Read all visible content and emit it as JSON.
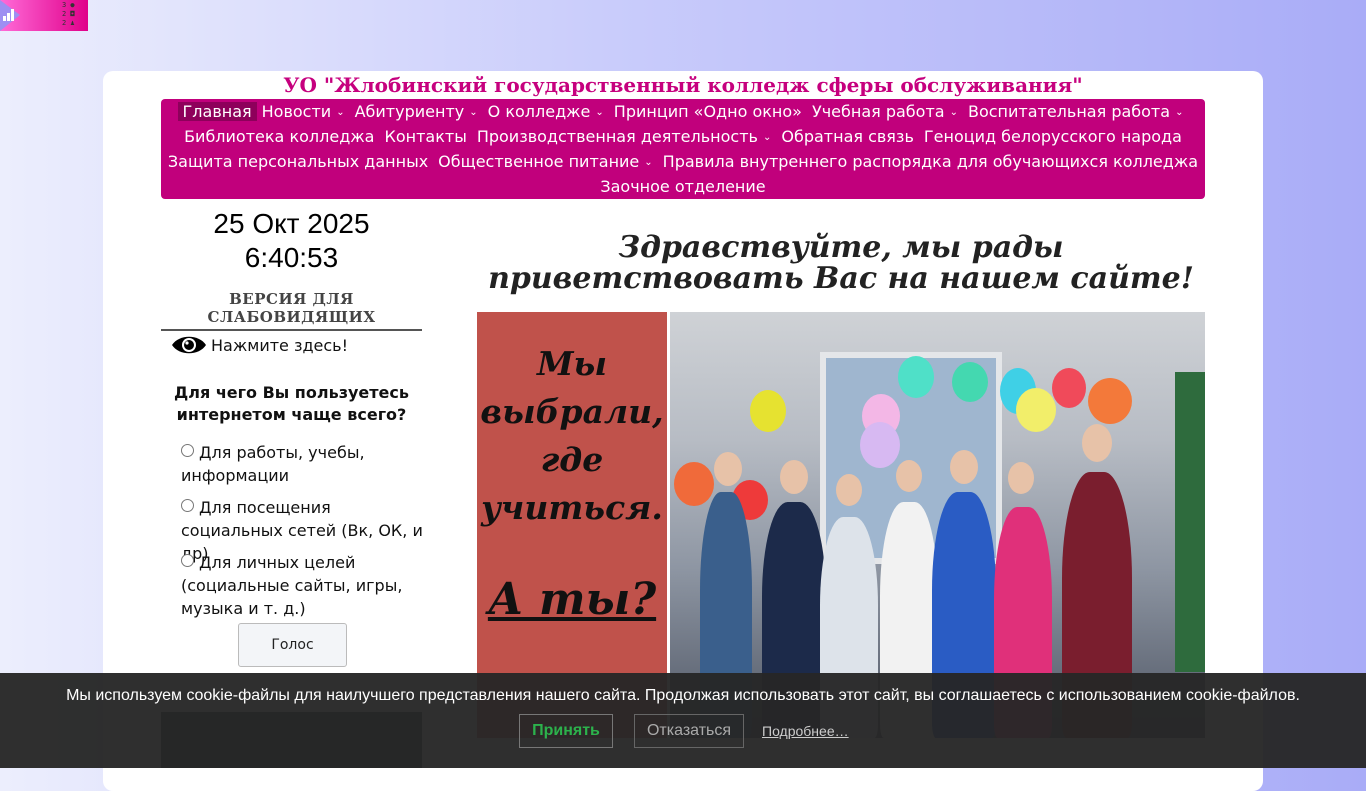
{
  "counter": {
    "numbers": [
      "3",
      "2",
      "2"
    ]
  },
  "site": {
    "title": "УО \"Жлобинский государственный колледж сферы обслуживания\""
  },
  "nav": {
    "rows": [
      [
        {
          "label": "Главная",
          "active": true,
          "dropdown": false
        },
        {
          "label": "Новости",
          "dropdown": true
        },
        {
          "label": "Абитуриенту",
          "dropdown": true
        },
        {
          "label": "О колледже",
          "dropdown": true
        },
        {
          "label": "Принцип «Одно окно»",
          "dropdown": false
        },
        {
          "label": "Учебная работа",
          "dropdown": true
        },
        {
          "label": "Воспитательная работа",
          "dropdown": true
        }
      ],
      [
        {
          "label": "Библиотека колледжа",
          "dropdown": false
        },
        {
          "label": "Контакты",
          "dropdown": false
        },
        {
          "label": "Производственная деятельность",
          "dropdown": true
        },
        {
          "label": "Обратная связь",
          "dropdown": false
        },
        {
          "label": "Геноцид белорусского народа",
          "dropdown": false
        }
      ],
      [
        {
          "label": "Защита персональных данных",
          "dropdown": false
        },
        {
          "label": "Общественное питание",
          "dropdown": true
        },
        {
          "label": "Правила внутреннего распорядка для обучающихся колледжа",
          "dropdown": false
        }
      ],
      [
        {
          "label": "Заочное отделение",
          "dropdown": false
        }
      ]
    ]
  },
  "clock": {
    "date": "25 Окт 2025",
    "time": "6:40:53"
  },
  "accessibility": {
    "heading": "ВЕРСИЯ ДЛЯ СЛАБОВИДЯЩИХ",
    "link": "Нажмите здесь!"
  },
  "poll": {
    "question": "Для чего Вы пользуетесь интернетом чаще всего?",
    "options": [
      "Для работы, учебы, информации",
      "Для посещения социальных сетей (Вк, ОК, и др)",
      "Для личных целей (социальные сайты, игры, музыка и т. д.)"
    ],
    "vote_label": "Голос"
  },
  "main": {
    "welcome": "Здравствуйте, мы рады приветствовать Вас на нашем сайте!",
    "banner": {
      "line1": "Мы выбрали, где учиться.",
      "line2": "А ты?"
    }
  },
  "cookie": {
    "message": "Мы используем cookie-файлы для наилучшего представления нашего сайта. Продолжая использовать этот сайт, вы соглашаетесь с использованием cookie-файлов.",
    "accept": "Принять",
    "decline": "Отказаться",
    "more": "Подробнее…"
  },
  "colors": {
    "brand": "#c1007c",
    "accept": "#2cb24c"
  },
  "icons": {
    "eye": "eye-icon",
    "chevron": "chevron-down-icon"
  }
}
